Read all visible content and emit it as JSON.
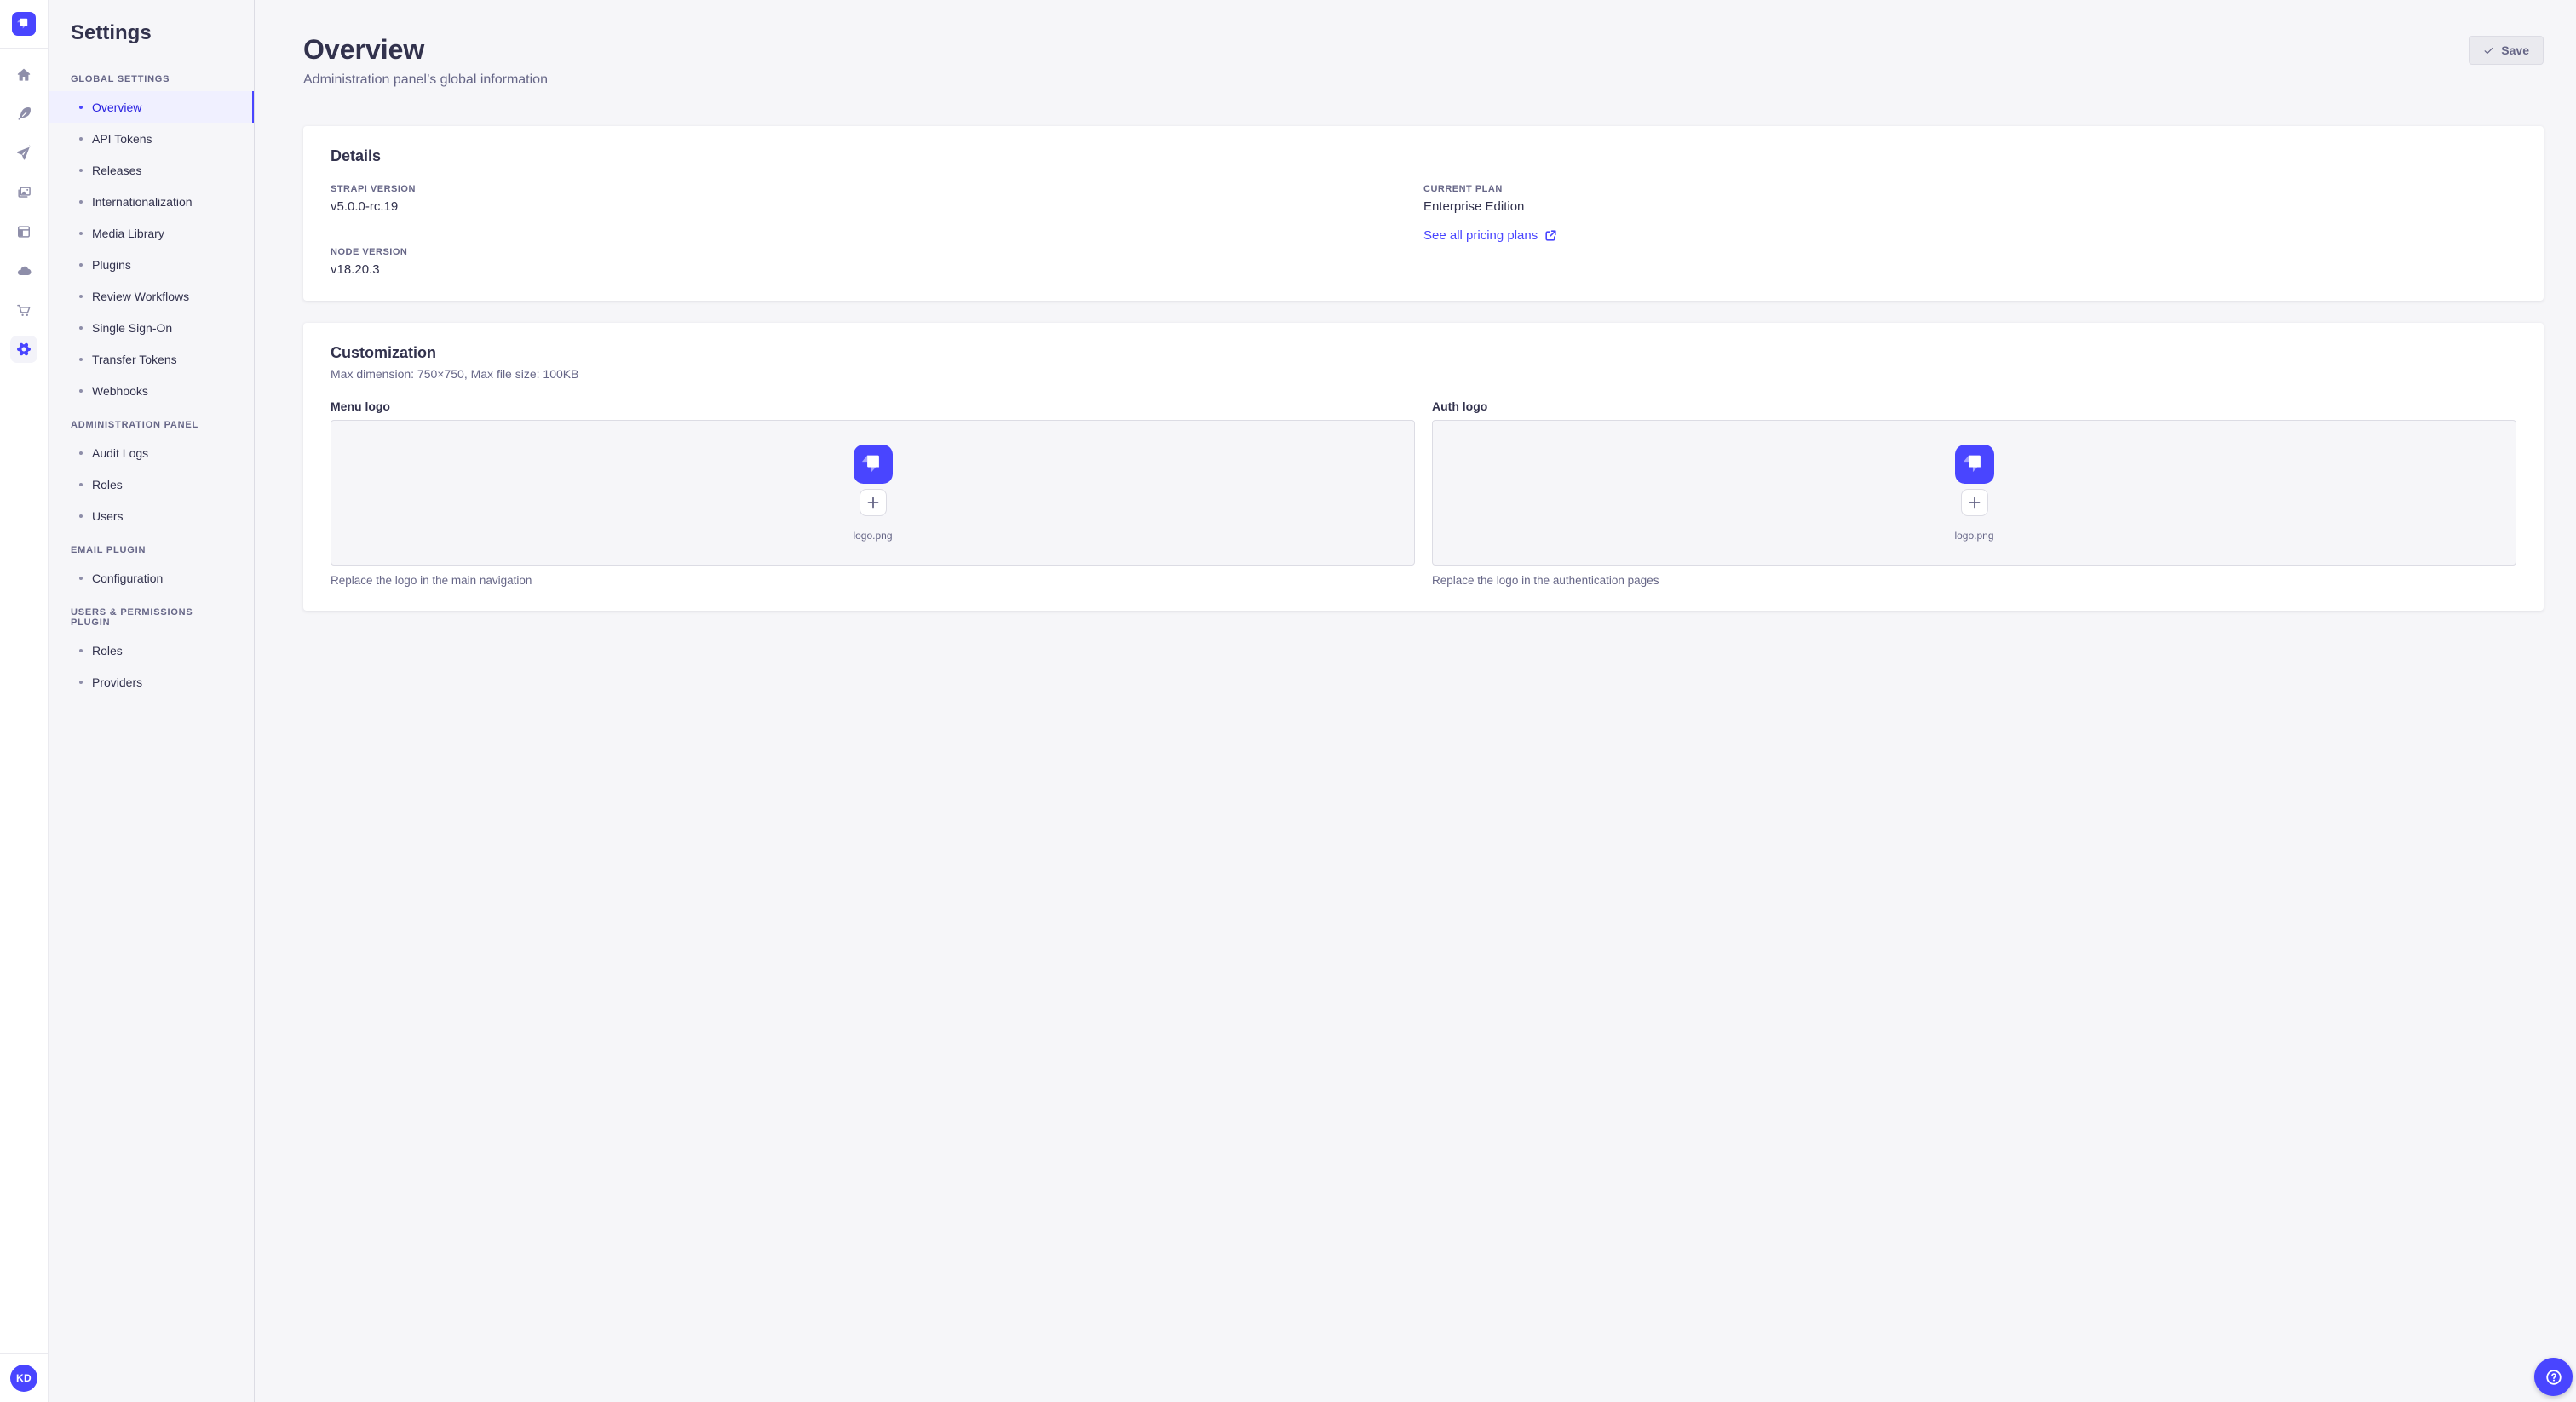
{
  "brand": {
    "primary_color": "#4945ff",
    "active_bg": "#f0f0ff",
    "active_text": "#271fe0"
  },
  "rail": {
    "logo_icon": "strapi-logo",
    "icons": [
      "home-icon",
      "feather-icon",
      "paper-plane-icon",
      "media-images-icon",
      "layout-icon",
      "cloud-icon",
      "cart-icon",
      "gear-icon"
    ],
    "active_icon": "gear-icon",
    "avatar_initials": "KD"
  },
  "sidebar": {
    "title": "Settings",
    "sections": [
      {
        "label": "GLOBAL SETTINGS",
        "items": [
          {
            "label": "Overview",
            "active": true
          },
          {
            "label": "API Tokens"
          },
          {
            "label": "Releases"
          },
          {
            "label": "Internationalization"
          },
          {
            "label": "Media Library"
          },
          {
            "label": "Plugins"
          },
          {
            "label": "Review Workflows"
          },
          {
            "label": "Single Sign-On"
          },
          {
            "label": "Transfer Tokens"
          },
          {
            "label": "Webhooks"
          }
        ]
      },
      {
        "label": "ADMINISTRATION PANEL",
        "items": [
          {
            "label": "Audit Logs"
          },
          {
            "label": "Roles"
          },
          {
            "label": "Users"
          }
        ]
      },
      {
        "label": "EMAIL PLUGIN",
        "items": [
          {
            "label": "Configuration"
          }
        ]
      },
      {
        "label": "USERS & PERMISSIONS PLUGIN",
        "items": [
          {
            "label": "Roles"
          },
          {
            "label": "Providers"
          }
        ]
      }
    ]
  },
  "header": {
    "title": "Overview",
    "subtitle": "Administration panel’s global information",
    "save_label": "Save"
  },
  "details": {
    "title": "Details",
    "strapi_version_label": "STRAPI VERSION",
    "strapi_version": "v5.0.0-rc.19",
    "node_version_label": "NODE VERSION",
    "node_version": "v18.20.3",
    "current_plan_label": "CURRENT PLAN",
    "current_plan": "Enterprise Edition",
    "pricing_link_label": "See all pricing plans"
  },
  "customization": {
    "title": "Customization",
    "subtitle": "Max dimension: 750×750, Max file size: 100KB",
    "menu_logo": {
      "label": "Menu logo",
      "filename": "logo.png",
      "description": "Replace the logo in the main navigation"
    },
    "auth_logo": {
      "label": "Auth logo",
      "filename": "logo.png",
      "description": "Replace the logo in the authentication pages"
    }
  }
}
